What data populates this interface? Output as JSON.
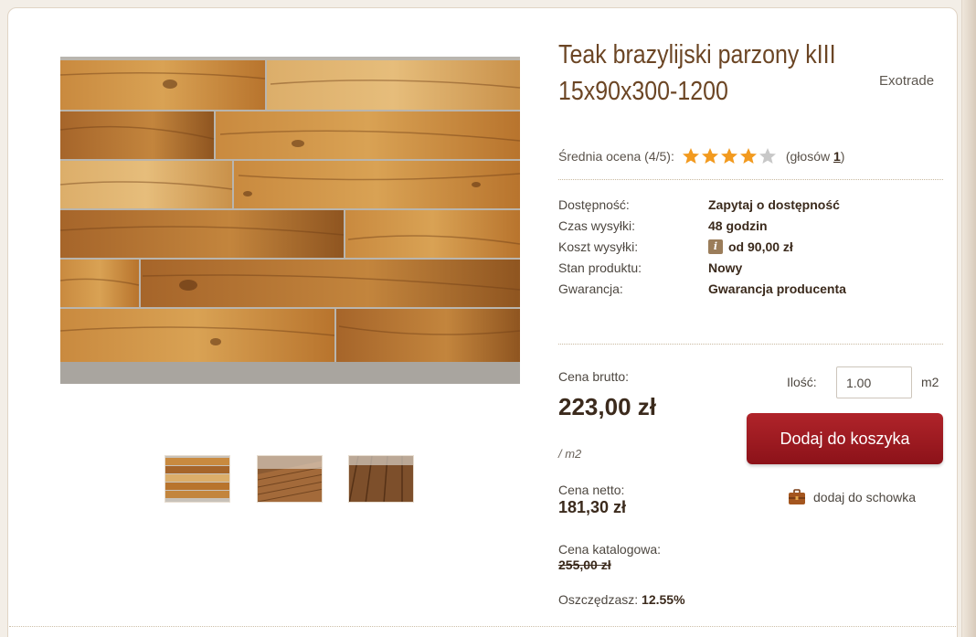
{
  "product": {
    "title": "Teak brazylijski parzony kIII 15x90x300-1200",
    "brand": "Exotrade"
  },
  "rating": {
    "label": "Średnia ocena (4/5):",
    "value": 4,
    "max": 5,
    "votes_prefix": "(głosów ",
    "votes_count": "1",
    "votes_suffix": ")"
  },
  "info": [
    {
      "label": "Dostępność:",
      "value": "Zapytaj o dostępność"
    },
    {
      "label": "Czas wysyłki:",
      "value": "48 godzin"
    },
    {
      "label": "Koszt wysyłki:",
      "value": "od 90,00 zł",
      "icon": "info-icon"
    },
    {
      "label": "Stan produktu:",
      "value": "Nowy"
    },
    {
      "label": "Gwarancja:",
      "value": "Gwarancja producenta"
    }
  ],
  "pricing": {
    "gross_label": "Cena brutto:",
    "gross_value": "223,00 zł",
    "unit": "/ m2",
    "net_label": "Cena netto:",
    "net_value": "181,30 zł",
    "catalog_label": "Cena katalogowa:",
    "catalog_value": "255,00 zł",
    "savings_label": "Oszczędzasz:",
    "savings_value": "12.55%"
  },
  "cart": {
    "qty_label": "Ilość:",
    "qty_value": "1.00",
    "qty_unit": "m2",
    "add_button": "Dodaj do koszyka",
    "save_link": "dodaj do schowka"
  },
  "colors": {
    "title": "#6b4524",
    "button": "#9c1a21",
    "star_on": "#f29a1f",
    "star_off": "#c8c8c8"
  }
}
